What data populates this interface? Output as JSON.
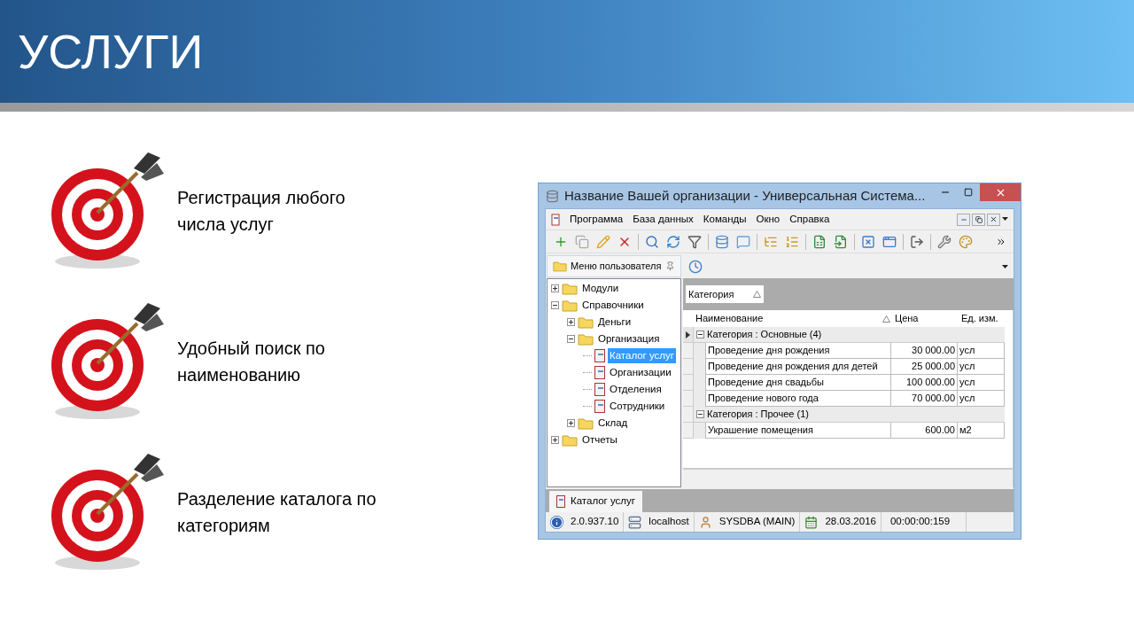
{
  "slide": {
    "title": "УСЛУГИ",
    "features": [
      {
        "text": "Регистрация любого\nчисла услуг"
      },
      {
        "text": "Удобный поиск по\nнаименованию"
      },
      {
        "text": "Разделение каталога по\nкатегориям"
      }
    ]
  },
  "window": {
    "title": "Название Вашей организации - Универсальная Система...",
    "menu": [
      "Программа",
      "База данных",
      "Команды",
      "Окно",
      "Справка"
    ],
    "side_panel": {
      "title": "Меню пользователя",
      "tree": [
        {
          "label": "Модули",
          "kind": "folder",
          "expanded": false,
          "selected": false
        },
        {
          "label": "Справочники",
          "kind": "folder",
          "expanded": true,
          "selected": false,
          "children": [
            {
              "label": "Деньги",
              "kind": "folder",
              "expanded": false,
              "selected": false
            },
            {
              "label": "Организация",
              "kind": "folder",
              "expanded": true,
              "selected": false,
              "children": [
                {
                  "label": "Каталог услуг",
                  "kind": "document",
                  "selected": true
                },
                {
                  "label": "Организации",
                  "kind": "document",
                  "selected": false
                },
                {
                  "label": "Отделения",
                  "kind": "document",
                  "selected": false
                },
                {
                  "label": "Сотрудники",
                  "kind": "document",
                  "selected": false
                }
              ]
            },
            {
              "label": "Склад",
              "kind": "folder",
              "expanded": false,
              "selected": false
            }
          ]
        },
        {
          "label": "Отчеты",
          "kind": "folder",
          "expanded": false,
          "selected": false
        }
      ]
    },
    "group_by": {
      "label": "Категория",
      "sorted": true
    },
    "columns": [
      {
        "label": "Наименование",
        "sorted": true
      },
      {
        "label": "Цена",
        "sorted": false
      },
      {
        "label": "Ед. изм.",
        "sorted": false
      }
    ],
    "groups": [
      {
        "label": "Категория : Основные (4)",
        "expanded": true,
        "current": true,
        "rows": [
          {
            "cells": [
              "Проведение дня рождения",
              "30 000.00",
              "усл"
            ]
          },
          {
            "cells": [
              "Проведение дня рождения для детей",
              "25 000.00",
              "усл"
            ]
          },
          {
            "cells": [
              "Проведение дня свадьбы",
              "100 000.00",
              "усл"
            ]
          },
          {
            "cells": [
              "Проведение нового года",
              "70 000.00",
              "усл"
            ]
          }
        ]
      },
      {
        "label": "Категория : Прочее (1)",
        "expanded": true,
        "current": false,
        "rows": [
          {
            "cells": [
              "Украшение помещения",
              "600.00",
              "м2"
            ]
          }
        ]
      }
    ],
    "tabs": [
      {
        "label": "Каталог услуг",
        "selected": true
      }
    ],
    "status_bar": [
      {
        "kind": "info",
        "text": "2.0.937.10"
      },
      {
        "kind": "server",
        "text": "localhost"
      },
      {
        "kind": "user",
        "text": "SYSDBA (MAIN)"
      },
      {
        "kind": "calendar",
        "text": "28.03.2016"
      },
      {
        "kind": "timer",
        "text": "00:00:00:159"
      }
    ]
  }
}
